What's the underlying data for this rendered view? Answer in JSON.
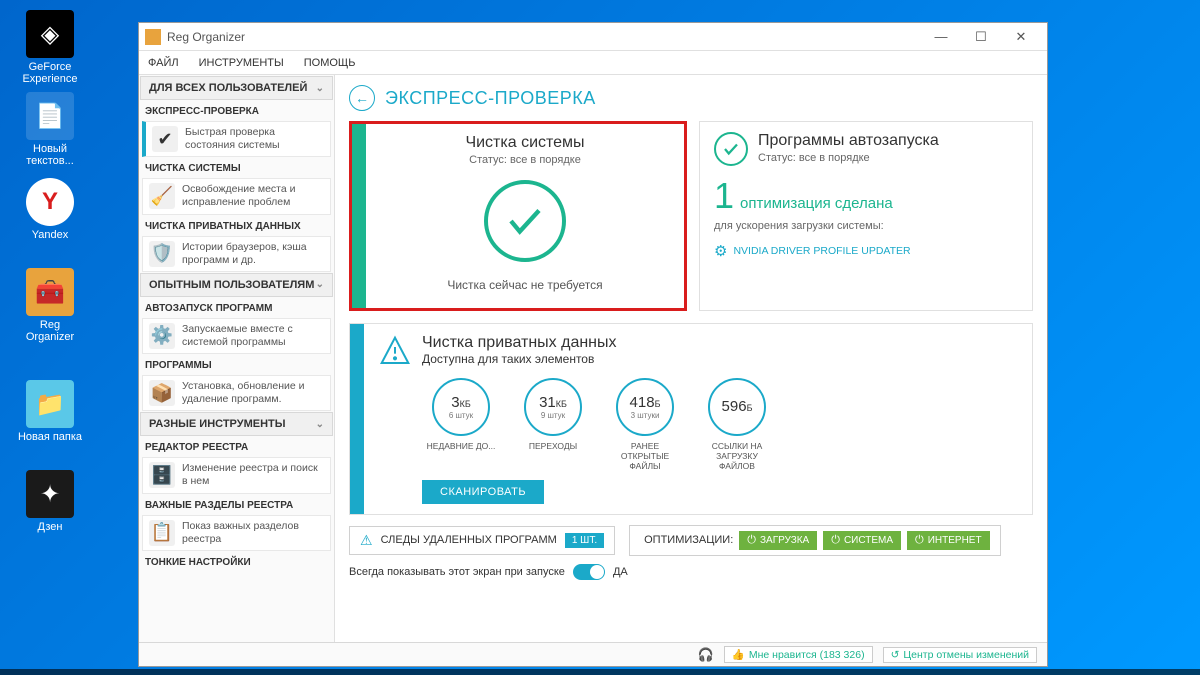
{
  "desktop": {
    "icons": [
      {
        "label": "GeForce Experience"
      },
      {
        "label": "Новый текстов..."
      },
      {
        "label": "Yandex"
      },
      {
        "label": "Reg Organizer"
      },
      {
        "label": "Новая папка"
      },
      {
        "label": "Дзен"
      }
    ]
  },
  "window": {
    "title": "Reg Organizer",
    "menu": [
      "ФАЙЛ",
      "ИНСТРУМЕНТЫ",
      "ПОМОЩЬ"
    ]
  },
  "sidebar": {
    "hdr1": "ДЛЯ ВСЕХ ПОЛЬЗОВАТЕЛЕЙ",
    "cat1": "ЭКСПРЕСС-ПРОВЕРКА",
    "item1": "Быстрая проверка состояния системы",
    "cat2": "ЧИСТКА СИСТЕМЫ",
    "item2": "Освобождение места и исправление проблем",
    "cat3": "ЧИСТКА ПРИВАТНЫХ ДАННЫХ",
    "item3": "Истории браузеров, кэша программ и др.",
    "hdr2": "ОПЫТНЫМ ПОЛЬЗОВАТЕЛЯМ",
    "cat4": "АВТОЗАПУСК ПРОГРАММ",
    "item4": "Запускаемые вместе с системой программы",
    "cat5": "ПРОГРАММЫ",
    "item5": "Установка, обновление и удаление программ.",
    "hdr3": "РАЗНЫЕ ИНСТРУМЕНТЫ",
    "cat6": "РЕДАКТОР РЕЕСТРА",
    "item6": "Изменение реестра и поиск в нем",
    "cat7": "ВАЖНЫЕ РАЗДЕЛЫ РЕЕСТРА",
    "item7": "Показ важных разделов реестра",
    "cat8": "ТОНКИЕ НАСТРОЙКИ"
  },
  "main": {
    "title": "ЭКСПРЕСС-ПРОВЕРКА",
    "card1": {
      "title": "Чистка системы",
      "status": "Статус: все в порядке",
      "footer": "Чистка сейчас не требуется"
    },
    "card2": {
      "title": "Программы автозапуска",
      "status": "Статус: все в порядке",
      "count": "1",
      "count_label": "оптимизация сделана",
      "sub": "для ускорения загрузки системы:",
      "item": "NVIDIA DRIVER PROFILE UPDATER"
    },
    "card3": {
      "title": "Чистка приватных данных",
      "sub": "Доступна для таких элементов",
      "circles": [
        {
          "val": "3",
          "unit": "КБ",
          "sub": "6 штук",
          "label": "НЕДАВНИЕ ДО..."
        },
        {
          "val": "31",
          "unit": "КБ",
          "sub": "9 штук",
          "label": "ПЕРЕХОДЫ"
        },
        {
          "val": "418",
          "unit": "Б",
          "sub": "3 штуки",
          "label": "РАНЕЕ ОТКРЫТЫЕ ФАЙЛЫ"
        },
        {
          "val": "596",
          "unit": "Б",
          "sub": "",
          "label": "ССЫЛКИ НА ЗАГРУЗКУ ФАЙЛОВ"
        }
      ],
      "scan": "СКАНИРОВАТЬ"
    },
    "traces": {
      "label": "СЛЕДЫ УДАЛЕННЫХ ПРОГРАММ",
      "badge": "1 ШТ."
    },
    "opts": {
      "label": "ОПТИМИЗАЦИИ:",
      "b1": "ЗАГРУЗКА",
      "b2": "СИСТЕМА",
      "b3": "ИНТЕРНЕТ"
    },
    "always": {
      "text": "Всегда показывать этот экран при запуске",
      "val": "ДА"
    }
  },
  "statusbar": {
    "likes": "Мне нравится (183 326)",
    "undo": "Центр отмены изменений"
  }
}
